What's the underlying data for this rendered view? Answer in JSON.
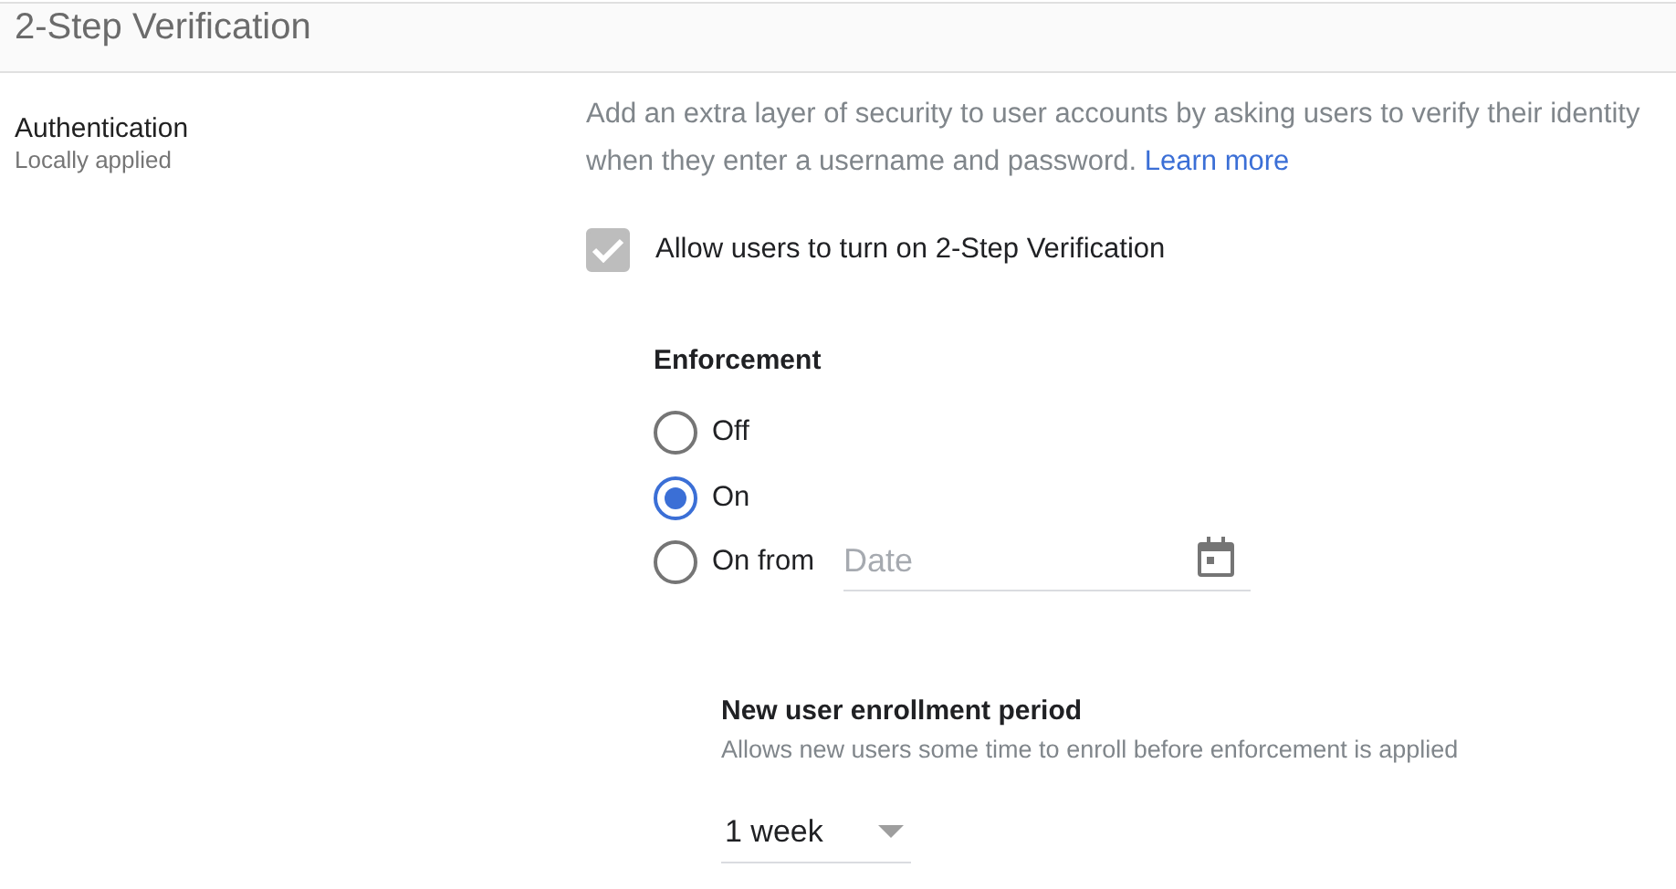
{
  "header": {
    "title": "2-Step Verification"
  },
  "setting": {
    "name": "Authentication",
    "scope": "Locally applied"
  },
  "description": {
    "text": "Add an extra layer of security to user accounts by asking users to verify their identity when they enter a username and password.",
    "link": "Learn more"
  },
  "allow_checkbox": {
    "label": "Allow users to turn on 2-Step Verification",
    "checked": true,
    "disabled": true
  },
  "enforcement": {
    "title": "Enforcement",
    "options": [
      {
        "label": "Off",
        "selected": false
      },
      {
        "label": "On",
        "selected": true
      },
      {
        "label": "On from",
        "selected": false,
        "date_placeholder": "Date"
      }
    ]
  },
  "enrollment": {
    "title": "New user enrollment period",
    "hint": "Allows new users some time to enroll before enforcement is applied",
    "value": "1 week"
  }
}
